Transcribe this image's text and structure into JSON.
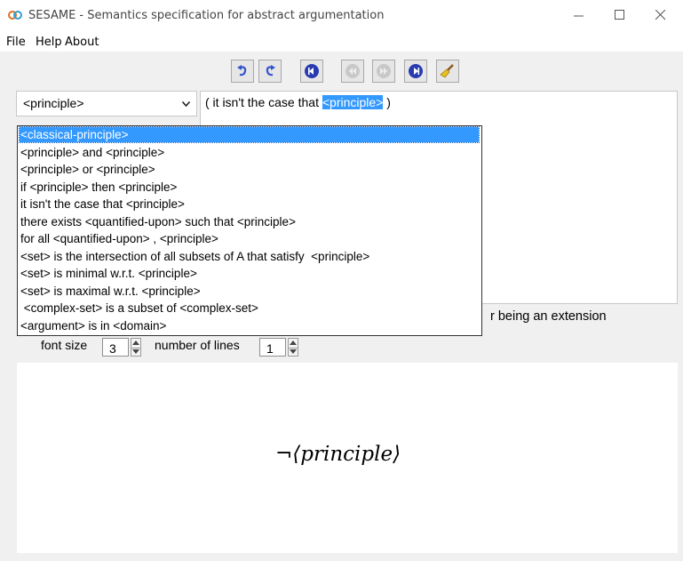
{
  "window": {
    "title": "SESAME - Semantics specification for abstract argumentation",
    "minimize_icon": "minimize-icon",
    "maximize_icon": "maximize-icon",
    "close_icon": "close-icon"
  },
  "menu": {
    "items": [
      "File",
      "Help",
      "About"
    ]
  },
  "toolbar": {
    "buttons": [
      {
        "icon": "undo-icon"
      },
      {
        "icon": "redo-icon"
      },
      {
        "icon": "first-icon"
      },
      {
        "icon": "previous-icon",
        "disabled": true
      },
      {
        "icon": "next-icon",
        "disabled": true
      },
      {
        "icon": "last-icon"
      },
      {
        "icon": "clear-broom-icon"
      }
    ]
  },
  "combo": {
    "value": "<principle>"
  },
  "editor": {
    "prefix": "( it isn't the case that ",
    "selected": "<principle>",
    "suffix": " )"
  },
  "dropdown": {
    "options": [
      "<classical-principle>",
      "<principle> and <principle>",
      "<principle> or <principle>",
      "if <principle> then <principle>",
      "it isn't the case that <principle>",
      "there exists <quantified-upon> such that <principle>",
      "for all <quantified-upon> , <principle>",
      "<set> is the intersection of all subsets of A that satisfy  <principle>",
      "<set> is minimal w.r.t. <principle>",
      "<set> is maximal w.r.t. <principle>",
      " <complex-set> is a subset of <complex-set>",
      "<argument> is in <domain>"
    ],
    "selected_index": 0
  },
  "description_tail": "r being an extension",
  "settings": {
    "font_size_label": "font size",
    "font_size_value": "3",
    "lines_label": "number of lines",
    "lines_value": "1"
  },
  "preview": {
    "negation": "¬",
    "formula": "⟨principle⟩"
  },
  "colors": {
    "selection": "#3399ff",
    "toolbar_blue": "#3355cc"
  }
}
